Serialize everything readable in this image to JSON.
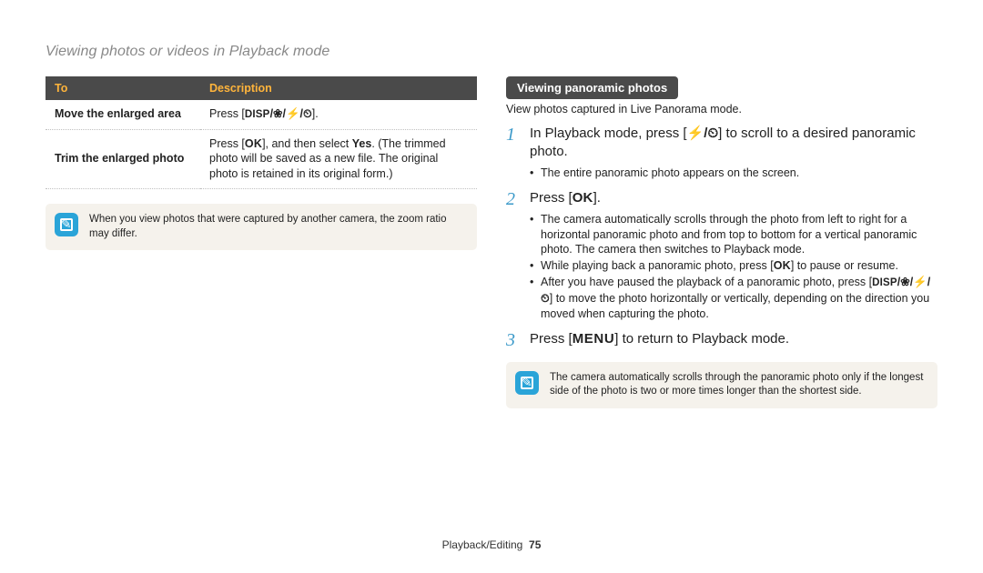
{
  "page_title": "Viewing photos or videos in Playback mode",
  "table": {
    "headers": {
      "to": "To",
      "description": "Description"
    },
    "rows": [
      {
        "to": "Move the enlarged area",
        "desc_prefix": "Press [",
        "desc_key": "DISP",
        "desc_syms": "/❀/⚡/⏲",
        "desc_suffix": "]."
      },
      {
        "to": "Trim the enlarged photo",
        "desc_prefix": "Press [",
        "desc_key": "OK",
        "desc_mid": "], and then select ",
        "desc_bold": "Yes",
        "desc_tail": ". (The trimmed photo will be saved as a new file. The original photo is retained in its original form.)"
      }
    ]
  },
  "note_left": "When you view photos that were captured by another camera, the zoom ratio may differ.",
  "right": {
    "heading": "Viewing panoramic photos",
    "sub": "View photos captured in Live Panorama mode.",
    "steps": {
      "s1_a": "In Playback mode, press [",
      "s1_syms": "⚡/⏲",
      "s1_b": "] to scroll to a desired panoramic photo.",
      "s1_sub1": "The entire panoramic photo appears on the screen.",
      "s2_a": "Press [",
      "s2_key": "OK",
      "s2_b": "].",
      "s2_sub1": "The camera automatically scrolls through the photo from left to right for a horizontal panoramic photo and from top to bottom for a vertical panoramic photo. The camera then switches to Playback mode.",
      "s2_sub2_a": "While playing back a panoramic photo, press [",
      "s2_sub2_key": "OK",
      "s2_sub2_b": "] to pause or resume.",
      "s2_sub3_a": "After you have paused the playback of a panoramic photo, press [",
      "s2_sub3_key": "DISP",
      "s2_sub3_syms": "/❀/⚡/⏲",
      "s2_sub3_b": "] to move the photo horizontally or vertically, depending on the direction you moved when capturing the photo.",
      "s3_a": "Press [",
      "s3_key": "MENU",
      "s3_b": "] to return to Playback mode."
    },
    "note": "The camera automatically scrolls through the panoramic photo only if the longest side of the photo is two or more times longer than the shortest side."
  },
  "footer": {
    "section": "Playback/Editing",
    "page": "75"
  }
}
